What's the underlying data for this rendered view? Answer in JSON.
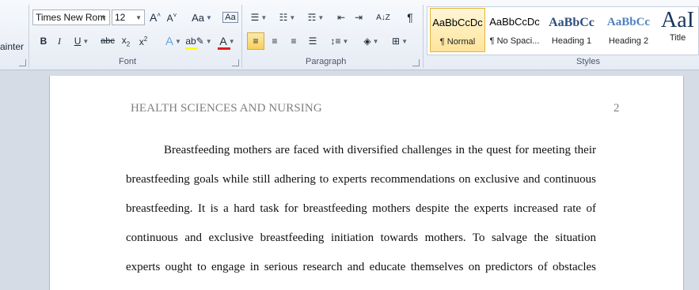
{
  "ribbon": {
    "clipboard_partial": "ainter",
    "font": {
      "label": "Font",
      "font_name": "Times New Rom",
      "font_size": "12"
    },
    "paragraph": {
      "label": "Paragraph"
    },
    "styles": {
      "label": "Styles",
      "items": [
        {
          "preview": "AaBbCcDc",
          "name": "¶ Normal"
        },
        {
          "preview": "AaBbCcDc",
          "name": "¶ No Spaci..."
        },
        {
          "preview": "AaBbCc",
          "name": "Heading 1"
        },
        {
          "preview": "AaBbCc",
          "name": "Heading 2"
        },
        {
          "preview": "AaI",
          "name": "Title"
        }
      ]
    }
  },
  "document": {
    "header": "HEALTH SCIENCES AND NURSING",
    "page_number": "2",
    "lines": [
      "Breastfeeding mothers are faced with diversified challenges in the quest for meeting their",
      "breastfeeding goals while still adhering to experts recommendations on exclusive and continuous",
      "breastfeeding. It is a hard task for breastfeeding mothers despite the experts increased rate of",
      "continuous and exclusive breastfeeding initiation towards mothers. To salvage the situation",
      "experts ought to engage in serious research and educate themselves on predictors of obstacles"
    ]
  },
  "colors": {
    "highlight": "#ffff00",
    "font_color": "#e21c1c",
    "selected_style": "#ffe49a"
  }
}
